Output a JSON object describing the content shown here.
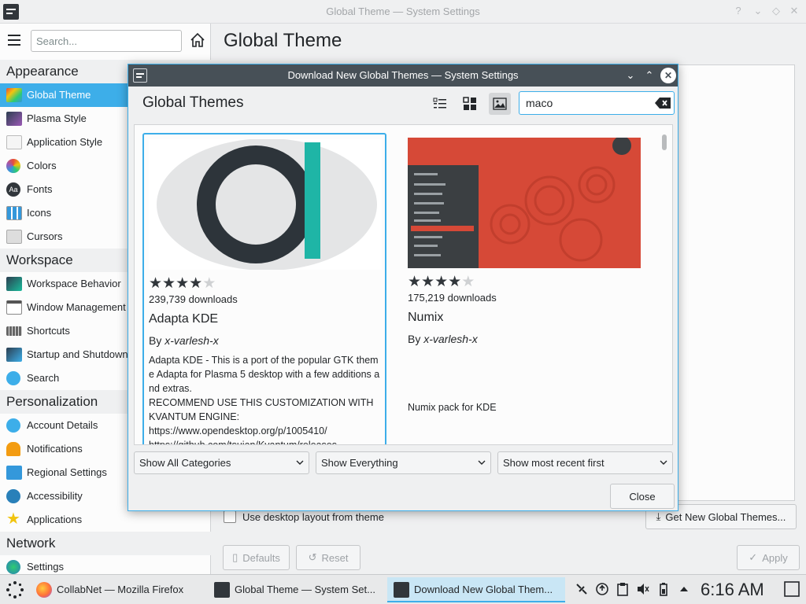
{
  "main_window": {
    "title": "Global Theme — System Settings",
    "search_placeholder": "Search...",
    "page_title": "Global Theme",
    "checkbox_label": "Use desktop layout from theme",
    "get_new_label": "Get New Global Themes...",
    "defaults_label": "Defaults",
    "reset_label": "Reset",
    "apply_label": "Apply"
  },
  "sidebar": {
    "appearance": "Appearance",
    "appearance_items": [
      "Global Theme",
      "Plasma Style",
      "Application Style",
      "Colors",
      "Fonts",
      "Icons",
      "Cursors"
    ],
    "workspace": "Workspace",
    "workspace_items": [
      "Workspace Behavior",
      "Window Management",
      "Shortcuts",
      "Startup and Shutdown",
      "Search"
    ],
    "personalization": "Personalization",
    "personalization_items": [
      "Account Details",
      "Notifications",
      "Regional Settings",
      "Accessibility",
      "Applications"
    ],
    "network": "Network",
    "network_items": [
      "Settings"
    ]
  },
  "dialog": {
    "title": "Download New Global Themes — System Settings",
    "heading": "Global Themes",
    "search_value": "maco",
    "cards": [
      {
        "rating": 4,
        "downloads": "239,739 downloads",
        "name": "Adapta KDE",
        "by": "By ",
        "author": "x-varlesh-x",
        "description": "Adapta KDE - This is a port of the popular GTK theme Adapta for Plasma 5 desktop with a few additions and extras.\nRECOMMEND USE THIS CUSTOMIZATION WITH KVANTUM ENGINE:\nhttps://www.opendesktop.org/p/1005410/\nhttps://github.com/tsujan/Kvantum/releases"
      },
      {
        "rating": 4,
        "downloads": "175,219 downloads",
        "name": "Numix",
        "by": "By ",
        "author": "x-varlesh-x",
        "description": "Numix pack for KDE"
      }
    ],
    "category_filter": "Show All Categories",
    "content_filter": "Show Everything",
    "sort_order": "Show most recent first",
    "close_label": "Close"
  },
  "taskbar": {
    "tasks": [
      "CollabNet — Mozilla Firefox",
      "Global Theme — System Set...",
      "Download New Global Them..."
    ],
    "clock": "6:16 AM"
  },
  "colors": {
    "accent": "#3daee9",
    "dialog_titlebar": "#475057"
  }
}
